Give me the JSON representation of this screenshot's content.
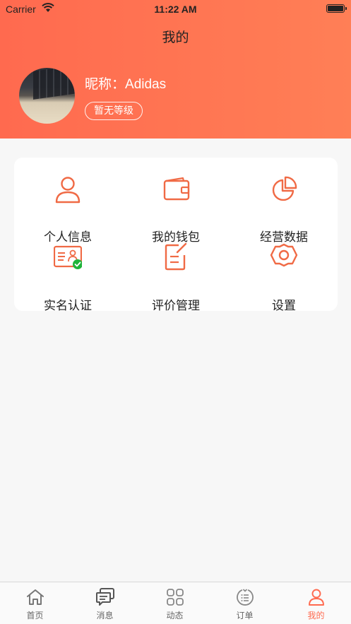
{
  "status_bar": {
    "carrier": "Carrier",
    "time": "11:22 AM"
  },
  "header": {
    "title": "我的",
    "nickname_label": "昵称：",
    "nickname_value": "Adidas",
    "level_badge": "暂无等级"
  },
  "colors": {
    "accent": "#ff6a4f",
    "accent_light": "#ff7f56",
    "icon": "#f06a45"
  },
  "menu": [
    {
      "label": "个人信息",
      "icon": "person-icon"
    },
    {
      "label": "我的钱包",
      "icon": "wallet-icon"
    },
    {
      "label": "经营数据",
      "icon": "pie-chart-icon"
    },
    {
      "label": "实名认证",
      "icon": "id-card-verified-icon"
    },
    {
      "label": "评价管理",
      "icon": "edit-document-icon"
    },
    {
      "label": "设置",
      "icon": "settings-icon"
    }
  ],
  "tabbar": [
    {
      "label": "首页",
      "icon": "home-icon"
    },
    {
      "label": "消息",
      "icon": "message-icon"
    },
    {
      "label": "动态",
      "icon": "grid-icon"
    },
    {
      "label": "订单",
      "icon": "order-icon"
    },
    {
      "label": "我的",
      "icon": "user-icon",
      "active": true
    }
  ]
}
